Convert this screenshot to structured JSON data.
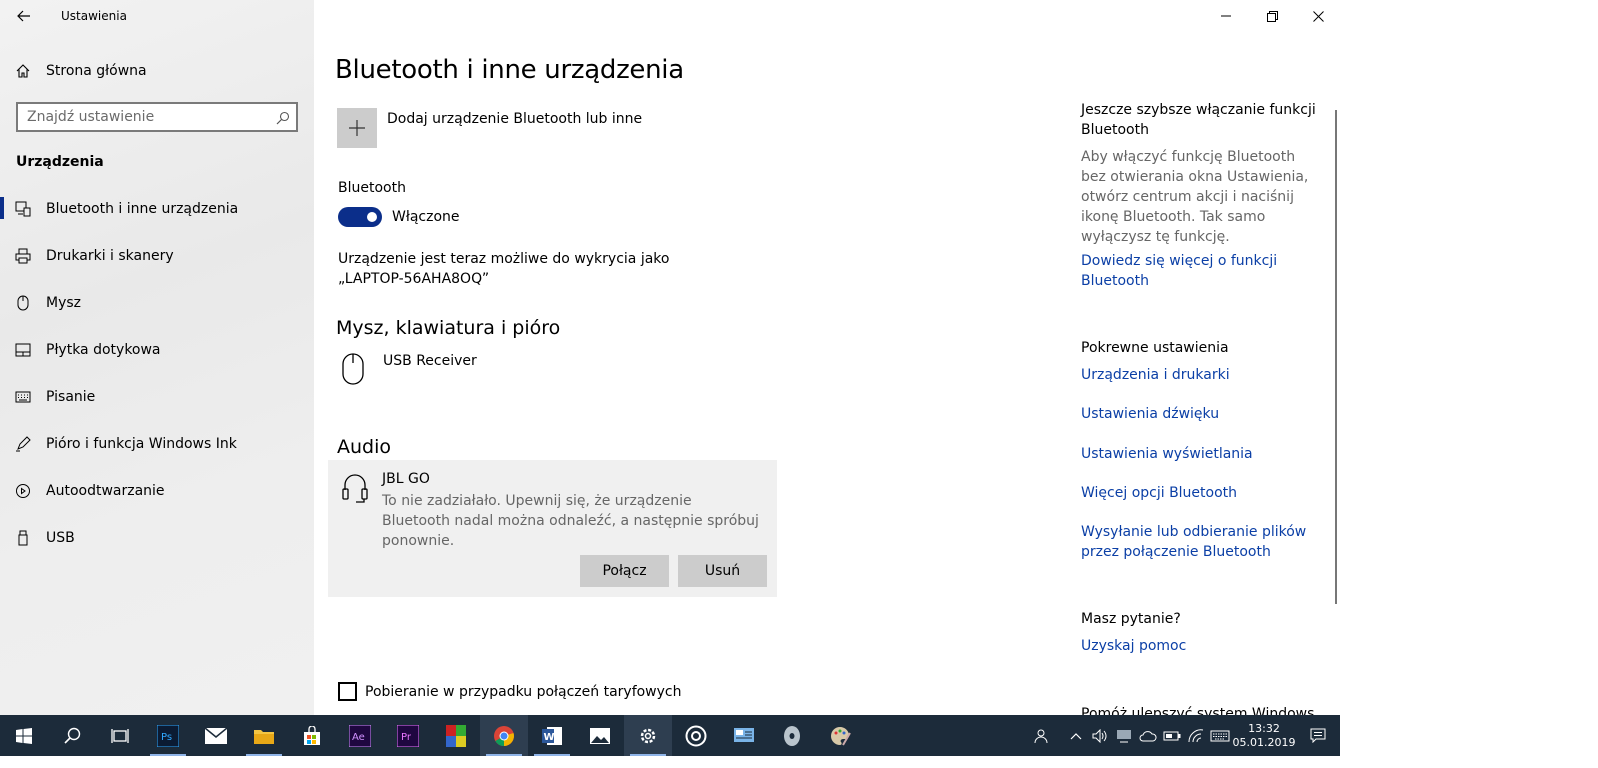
{
  "window": {
    "title": "Ustawienia",
    "controls": {
      "minimize": "minimize",
      "restore": "restore",
      "close": "close"
    }
  },
  "sidebar": {
    "home_label": "Strona główna",
    "search_placeholder": "Znajdź ustawienie",
    "section": "Urządzenia",
    "items": [
      {
        "label": "Bluetooth i inne urządzenia",
        "icon": "bluetooth-devices-icon",
        "active": true
      },
      {
        "label": "Drukarki i skanery",
        "icon": "printer-icon"
      },
      {
        "label": "Mysz",
        "icon": "mouse-icon"
      },
      {
        "label": "Płytka dotykowa",
        "icon": "touchpad-icon"
      },
      {
        "label": "Pisanie",
        "icon": "keyboard-icon"
      },
      {
        "label": "Pióro i funkcja Windows Ink",
        "icon": "pen-icon"
      },
      {
        "label": "Autoodtwarzanie",
        "icon": "autoplay-icon"
      },
      {
        "label": "USB",
        "icon": "usb-icon"
      }
    ]
  },
  "main": {
    "title": "Bluetooth i inne urządzenia",
    "add_device": "Dodaj urządzenie Bluetooth lub inne",
    "bluetooth_label": "Bluetooth",
    "bluetooth_toggle": "Włączone",
    "discoverable_line1": "Urządzenie jest teraz możliwe do wykrycia jako",
    "discoverable_line2": "„LAPTOP-56AHA8OQ”",
    "mouse_section": "Mysz, klawiatura i pióro",
    "mouse_device": "USB Receiver",
    "audio_section": "Audio",
    "audio_device": {
      "name": "JBL GO",
      "message": "To nie zadziałało. Upewnij się, że urządzenie Bluetooth nadal można odnaleźć, a następnie spróbuj ponownie.",
      "connect": "Połącz",
      "remove": "Usuń"
    },
    "metered_checkbox": "Pobieranie w przypadku połączeń taryfowych"
  },
  "right": {
    "tip_heading": "Jeszcze szybsze włączanie funkcji Bluetooth",
    "tip_text": "Aby włączyć funkcję Bluetooth bez otwierania okna Ustawienia, otwórz centrum akcji i naciśnij ikonę Bluetooth. Tak samo wyłączysz tę funkcję.",
    "tip_link": "Dowiedz się więcej o funkcji Bluetooth",
    "related_heading": "Pokrewne ustawienia",
    "related_links": [
      "Urządzenia i drukarki",
      "Ustawienia dźwięku",
      "Ustawienia wyświetlania",
      "Więcej opcji Bluetooth",
      "Wysyłanie lub odbieranie plików przez połączenie Bluetooth"
    ],
    "question_heading": "Masz pytanie?",
    "help_link": "Uzyskaj pomoc",
    "improve_heading": "Pomóż ulepszyć system Windows"
  },
  "taskbar": {
    "time": "13:32",
    "date": "05.01.2019",
    "apps": [
      "start",
      "search",
      "task-view",
      "photoshop",
      "mail",
      "file-explorer",
      "store",
      "after-effects",
      "premiere",
      "winrar",
      "chrome",
      "word",
      "photos",
      "settings",
      "groove",
      "control-panel",
      "cd",
      "paint"
    ]
  },
  "colors": {
    "accent": "#0b2e8a",
    "link": "#0b3fa6",
    "taskbar": "#1c2b3a"
  }
}
